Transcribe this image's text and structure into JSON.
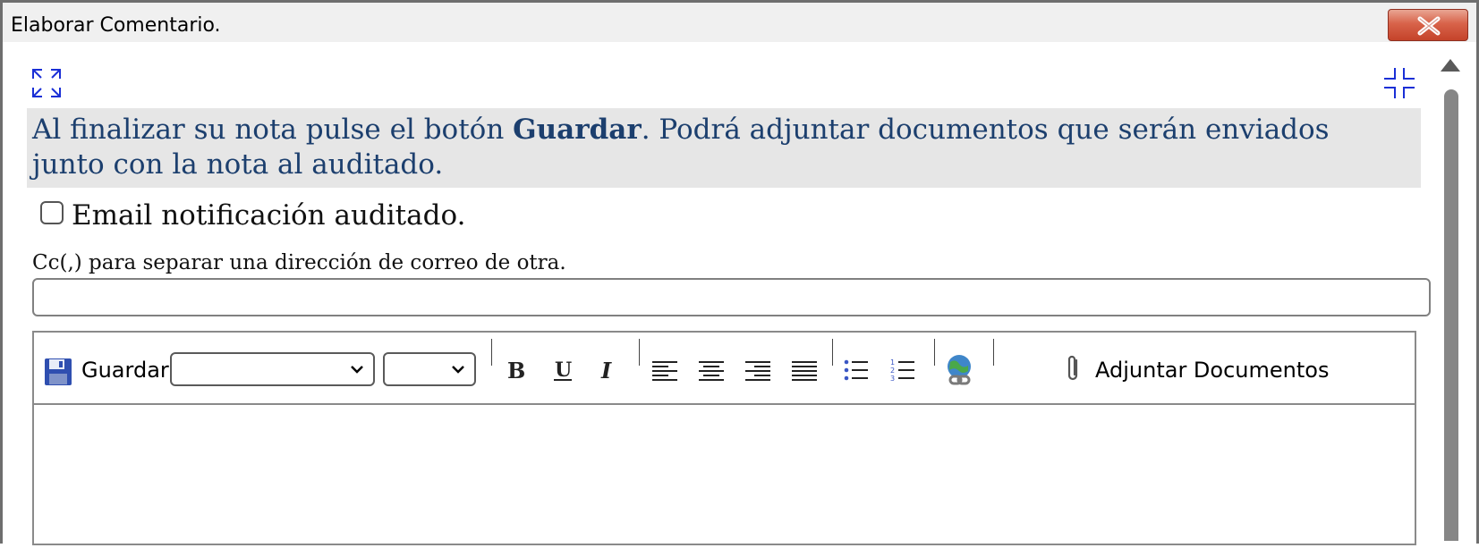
{
  "window": {
    "title": "Elaborar Comentario."
  },
  "instructions": {
    "before": "Al finalizar su nota pulse el botón ",
    "bold": "Guardar",
    "after": ". Podrá adjuntar documentos que serán enviados junto con la nota al auditado."
  },
  "notify": {
    "label": "Email notificación auditado.",
    "checked": false
  },
  "cc": {
    "label": "Cc(,) para separar una dirección de correo de otra.",
    "value": ""
  },
  "toolbar": {
    "save_label": "Guardar",
    "font_family_value": "",
    "font_size_value": "",
    "attach_label": "Adjuntar Documentos",
    "icons": [
      "save-icon",
      "bold-icon",
      "underline-icon",
      "italic-icon",
      "align-left-icon",
      "align-center-icon",
      "align-right-icon",
      "align-justify-icon",
      "bullet-list-icon",
      "numbered-list-icon",
      "insert-link-icon",
      "paperclip-icon"
    ]
  },
  "colors": {
    "note_text": "#1c3f6e",
    "note_bg": "#e6e6e6",
    "icon_blue": "#1a2fd6",
    "close_red": "#c4432a"
  }
}
